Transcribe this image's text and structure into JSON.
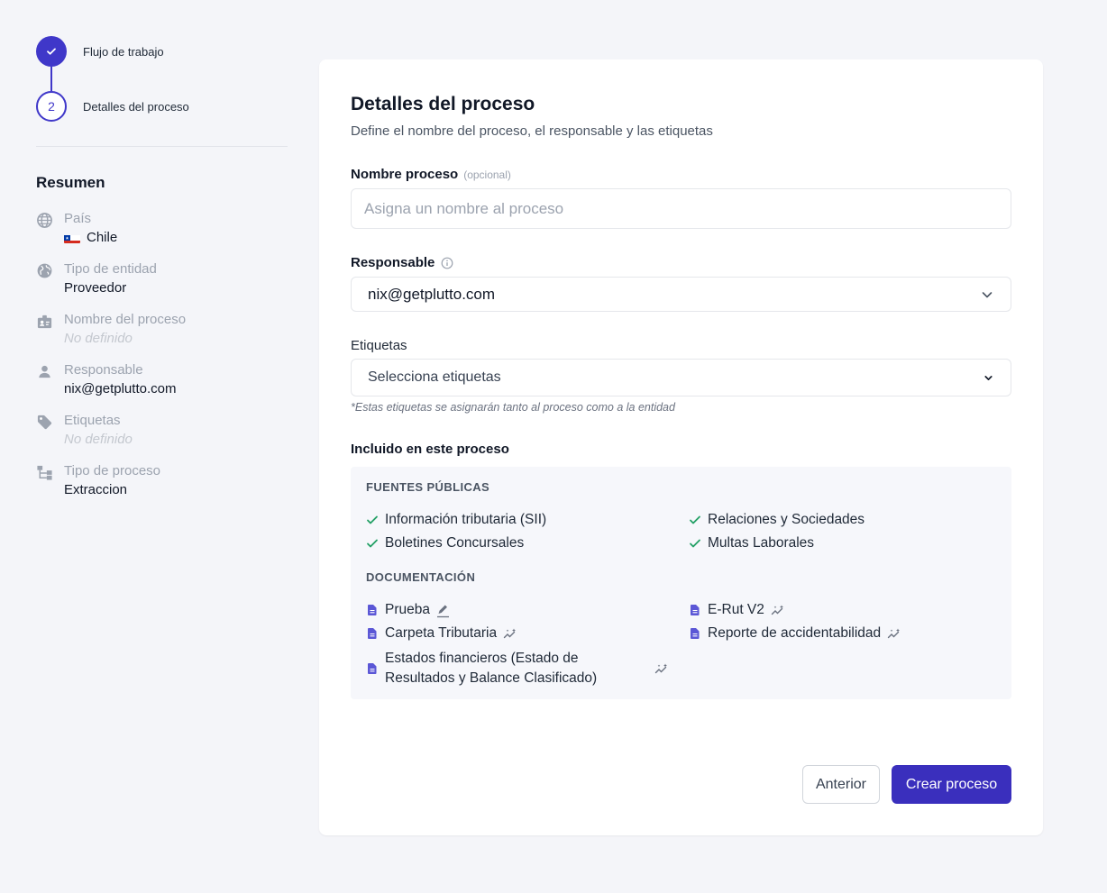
{
  "steps": [
    {
      "label": "Flujo de trabajo",
      "state": "done"
    },
    {
      "label": "Detalles del proceso",
      "number": "2",
      "state": "current"
    }
  ],
  "summary": {
    "title": "Resumen",
    "items": [
      {
        "label": "País",
        "value": "Chile",
        "icon": "globe-icon",
        "flag": "chile-flag"
      },
      {
        "label": "Tipo de entidad",
        "value": "Proveedor",
        "icon": "globe-filled-icon"
      },
      {
        "label": "Nombre del proceso",
        "value": "No definido",
        "icon": "id-badge-icon"
      },
      {
        "label": "Responsable",
        "value": "nix@getplutto.com",
        "icon": "person-icon"
      },
      {
        "label": "Etiquetas",
        "value": "No definido",
        "icon": "tag-icon"
      },
      {
        "label": "Tipo de proceso",
        "value": "Extraccion",
        "icon": "flow-icon"
      }
    ]
  },
  "form": {
    "title": "Detalles del proceso",
    "subtitle": "Define el nombre del proceso, el responsable y las etiquetas",
    "name_label": "Nombre proceso",
    "name_optional": "(opcional)",
    "name_placeholder": "Asigna un nombre al proceso",
    "responsible_label": "Responsable",
    "responsible_value": "nix@getplutto.com",
    "tags_label": "Etiquetas",
    "tags_placeholder": "Selecciona etiquetas",
    "tags_hint": "*Estas etiquetas se asignarán tanto al proceso como a la entidad",
    "included_label": "Incluido en este proceso"
  },
  "included": {
    "public_sources_title": "FUENTES PÚBLICAS",
    "public_sources": [
      "Información tributaria (SII)",
      "Relaciones y Sociedades",
      "Boletines Concursales",
      "Multas Laborales"
    ],
    "documentation_title": "DOCUMENTACIÓN",
    "documents": [
      {
        "label": "Prueba",
        "badge": "pencil-icon"
      },
      {
        "label": "E-Rut V2",
        "badge": "sparkle-icon"
      },
      {
        "label": "Carpeta Tributaria",
        "badge": "sparkle-icon"
      },
      {
        "label": "Reporte de accidentabilidad",
        "badge": "sparkle-icon"
      },
      {
        "label_line1": "Estados financieros (Estado de",
        "label_line2": "Resultados y Balance Clasificado)",
        "badge": "sparkle-icon"
      }
    ]
  },
  "buttons": {
    "previous": "Anterior",
    "create": "Crear proceso"
  },
  "colors": {
    "accent": "#3f37c9",
    "primary_button": "#3a2fbd",
    "check": "#22a065",
    "document_icon": "#5b57d6",
    "background": "#f4f5f9"
  }
}
